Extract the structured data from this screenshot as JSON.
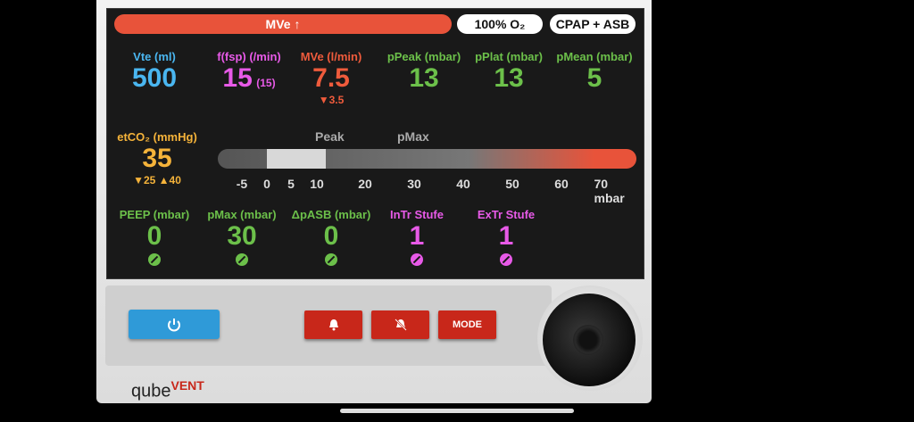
{
  "screen": {
    "alarm_text": "MVe ↑",
    "oxygen": "100% O₂",
    "mode": "CPAP + ASB"
  },
  "top_params": [
    {
      "label": "Vte (ml)",
      "value": "500",
      "color": "blue"
    },
    {
      "label": "f(fsp) (/min)",
      "value": "15",
      "extra": "(15)",
      "color": "pink"
    },
    {
      "label": "MVe (l/min)",
      "value": "7.5",
      "sub": "▼3.5",
      "color": "red"
    },
    {
      "label": "pPeak (mbar)",
      "value": "13",
      "color": "green"
    },
    {
      "label": "pPlat (mbar)",
      "value": "13",
      "color": "green"
    },
    {
      "label": "pMean (mbar)",
      "value": "5",
      "color": "green"
    }
  ],
  "etco2": {
    "label": "etCO₂ (mmHg)",
    "value": "35",
    "low": "▼25",
    "high": "▲40"
  },
  "gauge": {
    "peak_label": "Peak",
    "pmax_label": "pMax",
    "ticks": [
      "-5",
      "0",
      "5",
      "10",
      "20",
      "30",
      "40",
      "50",
      "60",
      "70 mbar"
    ],
    "peak_value": 13,
    "pmax_value": 30
  },
  "settings": [
    {
      "label": "PEEP (mbar)",
      "value": "0",
      "color": "green"
    },
    {
      "label": "pMax (mbar)",
      "value": "30",
      "color": "green"
    },
    {
      "label": "ΔpASB (mbar)",
      "value": "0",
      "color": "green"
    },
    {
      "label": "InTr Stufe",
      "value": "1",
      "color": "pink"
    },
    {
      "label": "ExTr Stufe",
      "value": "1",
      "color": "pink"
    }
  ],
  "controls": {
    "mode_label": "MODE"
  },
  "brand": {
    "name": "qube",
    "suffix": "VENT"
  },
  "colors": {
    "alarm": "#e8533a",
    "accent_blue": "#2f9ad8",
    "button_red": "#c8271a"
  }
}
